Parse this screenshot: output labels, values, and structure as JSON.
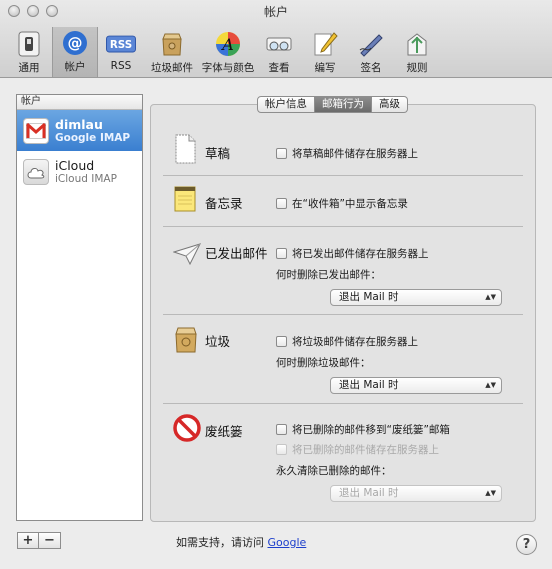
{
  "window": {
    "title": "帐户"
  },
  "toolbar": {
    "items": [
      {
        "label": "通用",
        "icon": "general-switch-icon"
      },
      {
        "label": "帐户",
        "icon": "at-sign-icon"
      },
      {
        "label": "RSS",
        "icon": "rss-icon"
      },
      {
        "label": "垃圾邮件",
        "icon": "junk-mail-icon"
      },
      {
        "label": "字体与颜色",
        "icon": "fonts-colors-icon"
      },
      {
        "label": "查看",
        "icon": "glasses-icon"
      },
      {
        "label": "编写",
        "icon": "compose-pencil-icon"
      },
      {
        "label": "签名",
        "icon": "signature-icon"
      },
      {
        "label": "规则",
        "icon": "rules-icon"
      }
    ],
    "rss_text": "RSS"
  },
  "accounts": {
    "header": "帐户",
    "items": [
      {
        "name": "dimlau",
        "type": "Google IMAP"
      },
      {
        "name": "iCloud",
        "type": "iCloud IMAP"
      }
    ],
    "add_label": "+",
    "remove_label": "−"
  },
  "tabs": {
    "info": "帐户信息",
    "behavior": "邮箱行为",
    "advanced": "高级"
  },
  "sections": {
    "drafts": {
      "title": "草稿",
      "store": "将草稿邮件储存在服务器上"
    },
    "notes": {
      "title": "备忘录",
      "show": "在“收件箱”中显示备忘录"
    },
    "sent": {
      "title": "已发出邮件",
      "store": "将已发出邮件储存在服务器上",
      "delete_label": "何时删除已发出邮件：",
      "delete_value": "退出 Mail 时"
    },
    "junk": {
      "title": "垃圾",
      "store": "将垃圾邮件储存在服务器上",
      "delete_label": "何时删除垃圾邮件：",
      "delete_value": "退出 Mail 时"
    },
    "trash": {
      "title": "废纸篓",
      "move": "将已删除的邮件移到“废纸篓”邮箱",
      "store": "将已删除的邮件储存在服务器上",
      "erase_label": "永久清除已删除的邮件：",
      "erase_value": "退出 Mail 时"
    }
  },
  "footer": {
    "support_text": "如需支持，请访问",
    "support_link": "Google",
    "help": "?"
  },
  "colors": {
    "selection": "#3a7fd0",
    "link": "#1d3fcc"
  }
}
